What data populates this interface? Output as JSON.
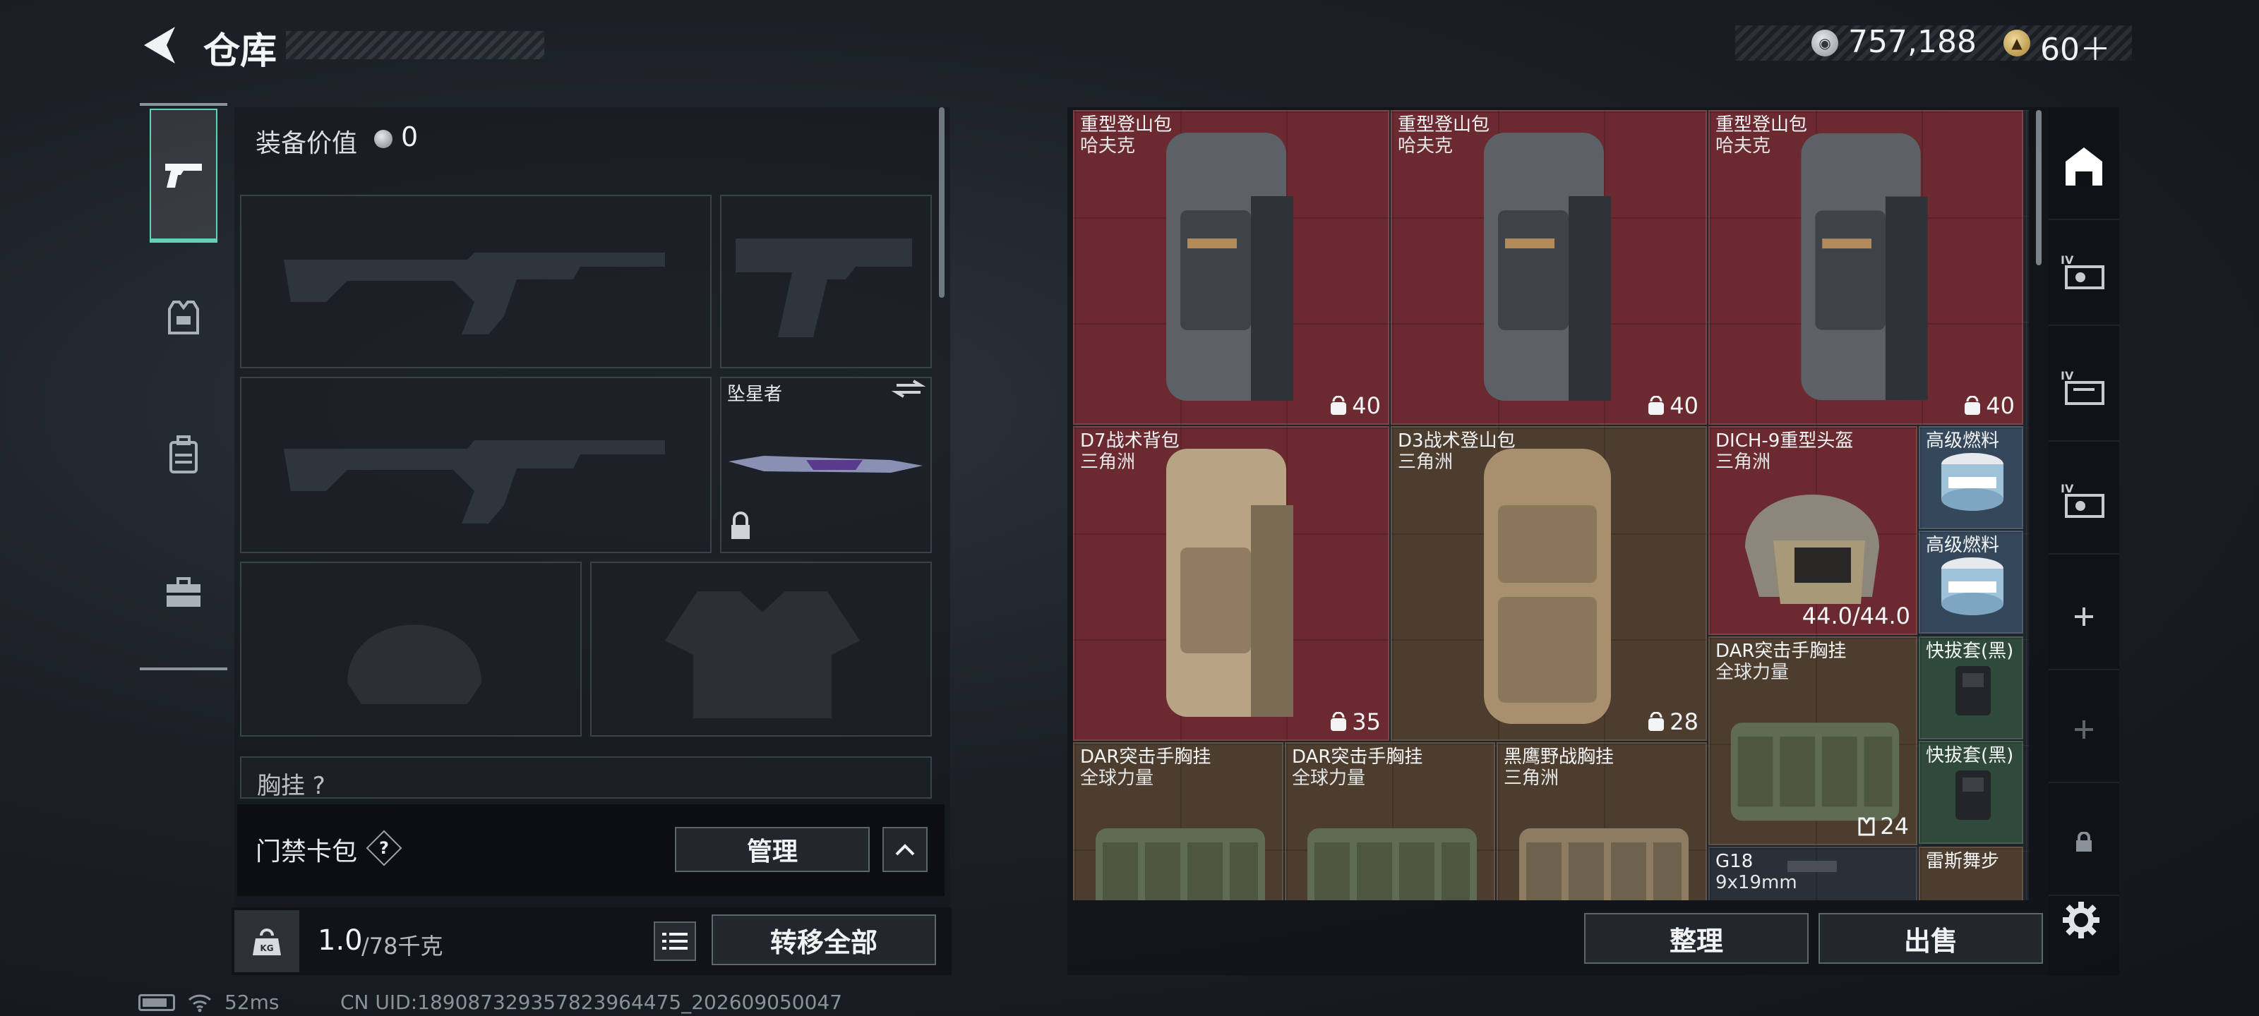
{
  "header": {
    "title": "仓库",
    "coin_value": "757,188",
    "gem_value": "60＋"
  },
  "left_tabs": [
    {
      "name": "weapons",
      "active": true
    },
    {
      "name": "gear"
    },
    {
      "name": "backpack"
    },
    {
      "name": "toolbox"
    }
  ],
  "loadout": {
    "equip_value_label": "装备价值",
    "equip_value": "0",
    "melee_name": "坠星者",
    "chest_label": "胸挂 ?"
  },
  "keycard": {
    "label": "门禁卡包",
    "help": "?",
    "manage_label": "管理"
  },
  "weight": {
    "current": "1.0",
    "max": "/78千克",
    "transfer_label": "转移全部"
  },
  "warehouse": {
    "items": [
      {
        "name": "重型登山包",
        "sub": "哈夫克",
        "count": "40",
        "color": "#6a2a30"
      },
      {
        "name": "重型登山包",
        "sub": "哈夫克",
        "count": "40",
        "color": "#6a2a30"
      },
      {
        "name": "重型登山包",
        "sub": "哈夫克",
        "count": "40",
        "color": "#6a2a30"
      },
      {
        "name": "D7战术背包",
        "sub": "三角洲",
        "count": "35",
        "color": "#6a2a30"
      },
      {
        "name": "D3战术登山包",
        "sub": "三角洲",
        "count": "28",
        "color": "#4c3d2e"
      },
      {
        "name": "DICH-9重型头盔",
        "sub": "三角洲",
        "durability": "44.0/44.0",
        "color": "#6a2a30"
      },
      {
        "name": "高级燃料",
        "color": "#35475a"
      },
      {
        "name": "高级燃料",
        "color": "#35475a"
      },
      {
        "name": "DAR突击手胸挂",
        "sub": "全球力量",
        "count": "24",
        "color": "#4c3d2e"
      },
      {
        "name": "快拔套(黑)",
        "color": "#2f4a3b"
      },
      {
        "name": "快拔套(黑)",
        "color": "#2f4a3b"
      },
      {
        "name": "DAR突击手胸挂",
        "sub": "全球力量",
        "color": "#4c3d2e"
      },
      {
        "name": "DAR突击手胸挂",
        "sub": "全球力量",
        "color": "#4c3d2e"
      },
      {
        "name": "黑鹰野战胸挂",
        "sub": "三角洲",
        "color": "#4c3d2e"
      },
      {
        "name": "G18",
        "sub": "9x19mm",
        "color": "#2a3037"
      },
      {
        "name": "雷斯舞步",
        "color": "#4c3d2e"
      }
    ],
    "sort_label": "整理",
    "sell_label": "出售"
  },
  "right_rail": [
    "warehouse-icon",
    "case-IV-icon",
    "case-IV-icon",
    "case-IV-icon",
    "plus-icon",
    "plus-icon",
    "lock-icon",
    "gear-icon"
  ],
  "status": {
    "ping": "52ms",
    "uid": "CN UID:1890873293578239644​75_202609050047"
  }
}
